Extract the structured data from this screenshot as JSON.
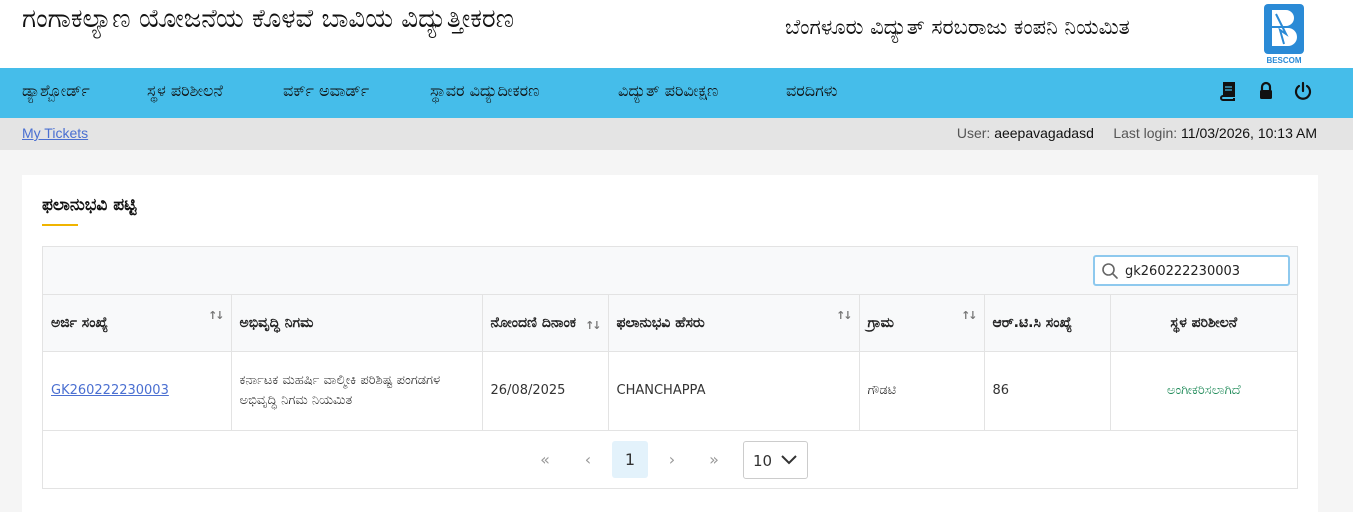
{
  "header": {
    "app_title": "ಗಂಗಾಕಲ್ಯಾಣ ಯೋಜನೆಯ ಕೊಳವೆ ಬಾವಿಯ ವಿದ್ಯುತ್ತೀಕರಣ",
    "company": "ಬೆಂಗಳೂರು ವಿದ್ಯುತ್ ಸರಬರಾಜು ಕಂಪನಿ ನಿಯಮಿತ",
    "logo_text": "BESCOM"
  },
  "nav": {
    "items": [
      {
        "label": "ಡ್ಯಾಶ್ಬೋರ್ಡ್"
      },
      {
        "label": "ಸ್ಥಳ ಪರಿಶೀಲನೆ"
      },
      {
        "label": "ವರ್ಕ್ ಅವಾರ್ಡ್"
      },
      {
        "label": "ಸ್ಥಾವರ ವಿದ್ಯುದೀಕರಣ"
      },
      {
        "label": "ವಿದ್ಯುತ್ ಪರಿವೀಕ್ಷಣ"
      },
      {
        "label": "ವರದಿಗಳು"
      }
    ],
    "icons": [
      "book-icon",
      "lock-icon",
      "power-icon"
    ]
  },
  "subbar": {
    "my_tickets": "My Tickets",
    "user_label": "User:",
    "user_value": "aeepavagadasd",
    "login_label": "Last login:",
    "login_value": "11/03/2026, 10:13 AM"
  },
  "card": {
    "title": "ಫಲಾನುಭವಿ ಪಟ್ಟಿ",
    "search_value": "gk260222230003",
    "columns": [
      {
        "label": "ಅರ್ಜಿ ಸಂಖ್ಯೆ",
        "sortable": true
      },
      {
        "label": "ಅಭಿವೃದ್ಧಿ ನಿಗಮ",
        "sortable": false
      },
      {
        "label": "ನೋಂದಣಿ ದಿನಾಂಕ",
        "sortable": true
      },
      {
        "label": "ಫಲಾನುಭವಿ ಹೆಸರು",
        "sortable": true
      },
      {
        "label": "ಗ್ರಾಮ",
        "sortable": true
      },
      {
        "label": "ಆರ್.ಟಿ.ಸಿ ಸಂಖ್ಯೆ",
        "sortable": false
      },
      {
        "label": "ಸ್ಥಳ ಪರಿಶೀಲನೆ",
        "sortable": false
      }
    ],
    "rows": [
      {
        "application_no": "GK260222230003",
        "corporation": "ಕರ್ನಾಟಕ ಮಹರ್ಷಿ ವಾಲ್ಮೀಕಿ ಪರಿಶಿಷ್ಟ ಪಂಗಡಗಳ ಅಭಿವೃದ್ಧಿ ನಿಗಮ ನಿಯಮಿತ",
        "reg_date": "26/08/2025",
        "beneficiary": "CHANCHAPPA",
        "village": "ಗೌಡಟಿ",
        "rtc_no": "86",
        "site_inspection": "ಅಂಗೀಕರಿಸಲಾಗಿದೆ"
      }
    ],
    "pager": {
      "first": "«",
      "prev": "‹",
      "current": "1",
      "next": "›",
      "last": "»",
      "per_page": "10"
    }
  },
  "colors": {
    "nav_bg": "#45bdea",
    "link": "#4a6fd1",
    "status_green": "#198754",
    "accent_underline": "#f0b400"
  }
}
